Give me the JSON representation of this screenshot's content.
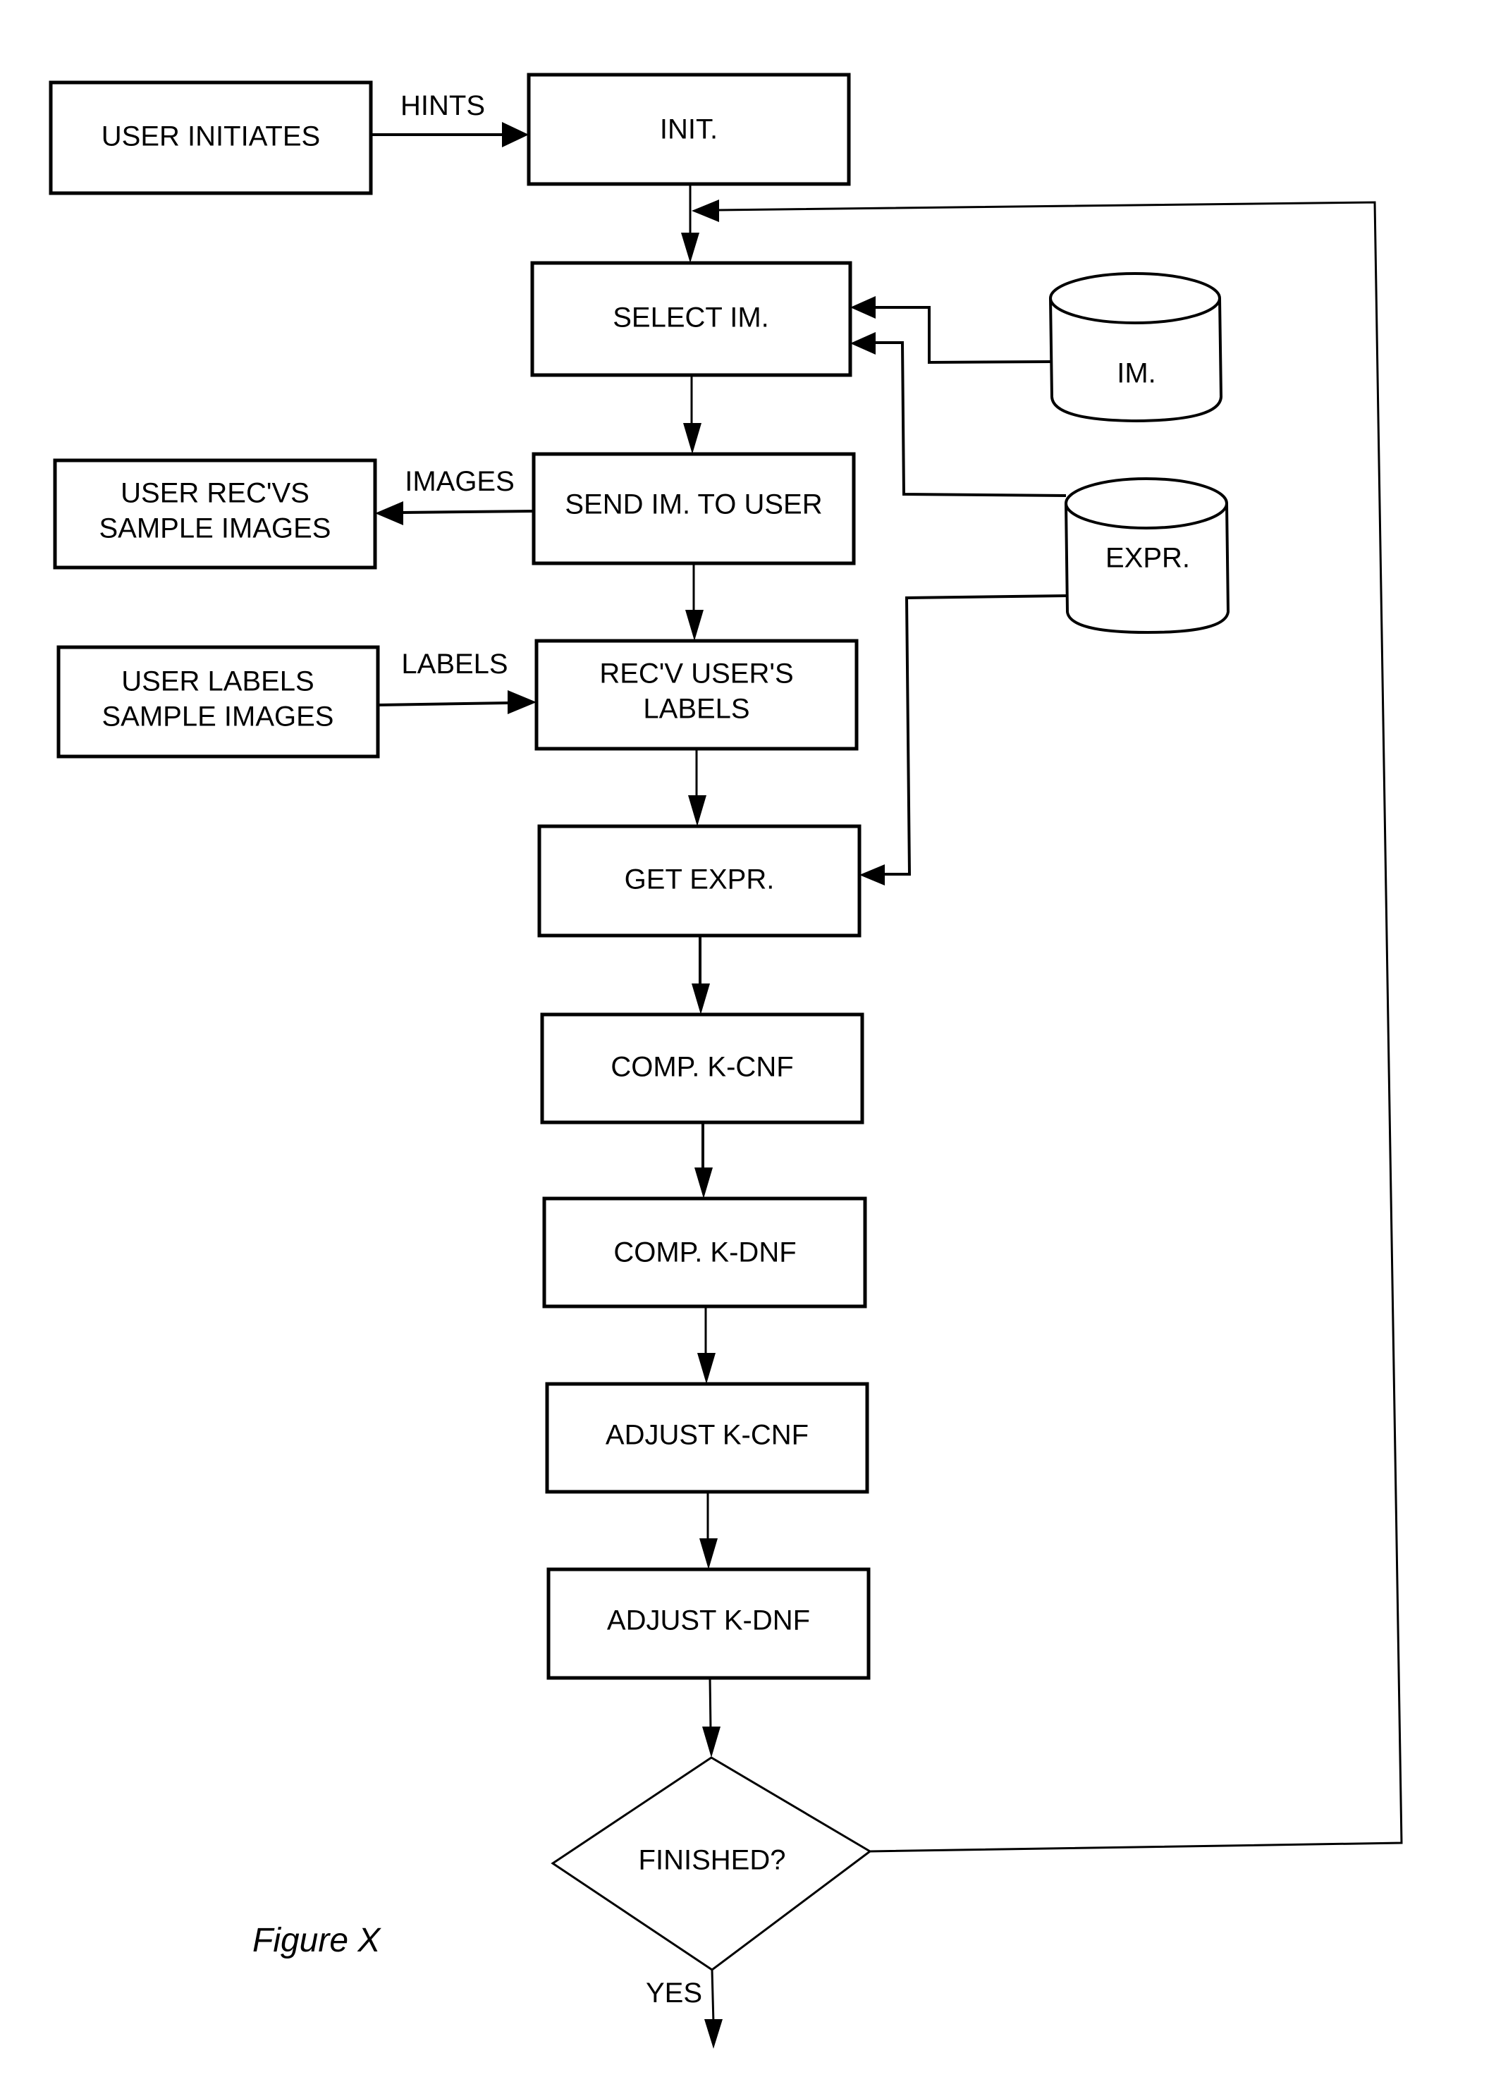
{
  "figure": {
    "caption": "Figure X",
    "nodes": {
      "user_initiates": "USER INITIATES",
      "init": "INIT.",
      "select_im": "SELECT IM.",
      "im_store": "IM.",
      "expr_store": "EXPR.",
      "user_recvs_line1": "USER REC'VS",
      "user_recvs_line2": "SAMPLE IMAGES",
      "send_im": "SEND IM. TO USER",
      "user_labels_line1": "USER LABELS",
      "user_labels_line2": "SAMPLE IMAGES",
      "recv_labels_line1": "REC'V USER'S",
      "recv_labels_line2": "LABELS",
      "get_expr": "GET EXPR.",
      "comp_kcnf": "COMP. K-CNF",
      "comp_kdnf": "COMP. K-DNF",
      "adjust_kcnf": "ADJUST K-CNF",
      "adjust_kdnf": "ADJUST K-DNF",
      "finished": "FINISHED?"
    },
    "edges": {
      "hints": "HINTS",
      "images": "IMAGES",
      "labels": "LABELS",
      "yes": "YES"
    }
  }
}
